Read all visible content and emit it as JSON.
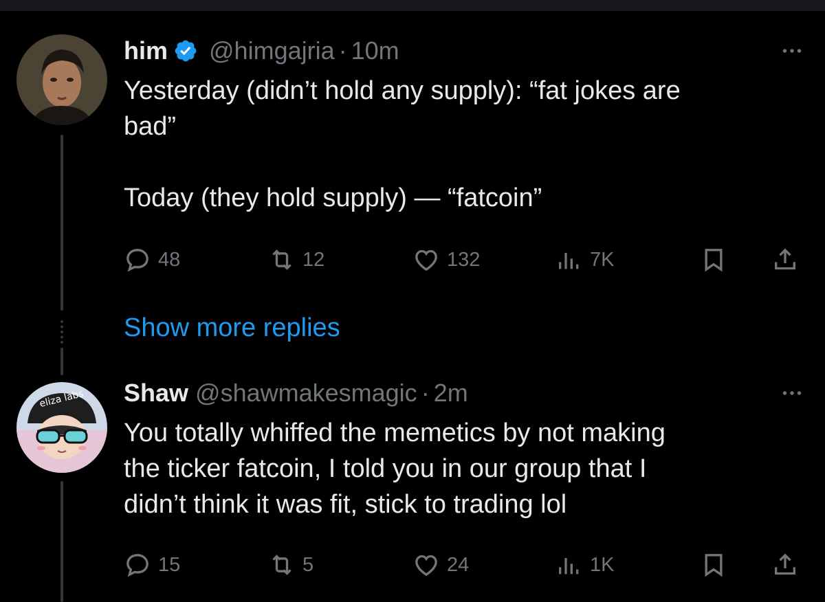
{
  "thread": [
    {
      "author_name": "him",
      "verified": true,
      "handle": "@himgajria",
      "separator": "·",
      "time": "10m",
      "text_lines": [
        "Yesterday (didn’t hold any supply): “fat jokes are",
        "bad”"
      ],
      "text_line_2": "Today (they hold supply) — “fatcoin”",
      "stats": {
        "replies": "48",
        "reposts": "12",
        "likes": "132",
        "views": "7K"
      }
    },
    {
      "author_name": "Shaw",
      "verified": false,
      "handle": "@shawmakesmagic",
      "separator": "·",
      "time": "2m",
      "text_lines": [
        "You totally whiffed the memetics by not making",
        "the ticker fatcoin, I told you in our group that I",
        "didn’t think it was fit, stick to trading lol"
      ],
      "stats": {
        "replies": "15",
        "reposts": "5",
        "likes": "24",
        "views": "1K"
      }
    }
  ],
  "show_more_label": "Show more replies",
  "avatar_2_text": "eliza labs",
  "colors": {
    "background": "#000000",
    "text": "#e7e9ea",
    "muted": "#71767b",
    "accent": "#1d9bf0"
  },
  "icons": [
    "reply-icon",
    "repost-icon",
    "like-icon",
    "views-icon",
    "bookmark-icon",
    "share-icon",
    "more-icon",
    "verified-badge-icon"
  ]
}
